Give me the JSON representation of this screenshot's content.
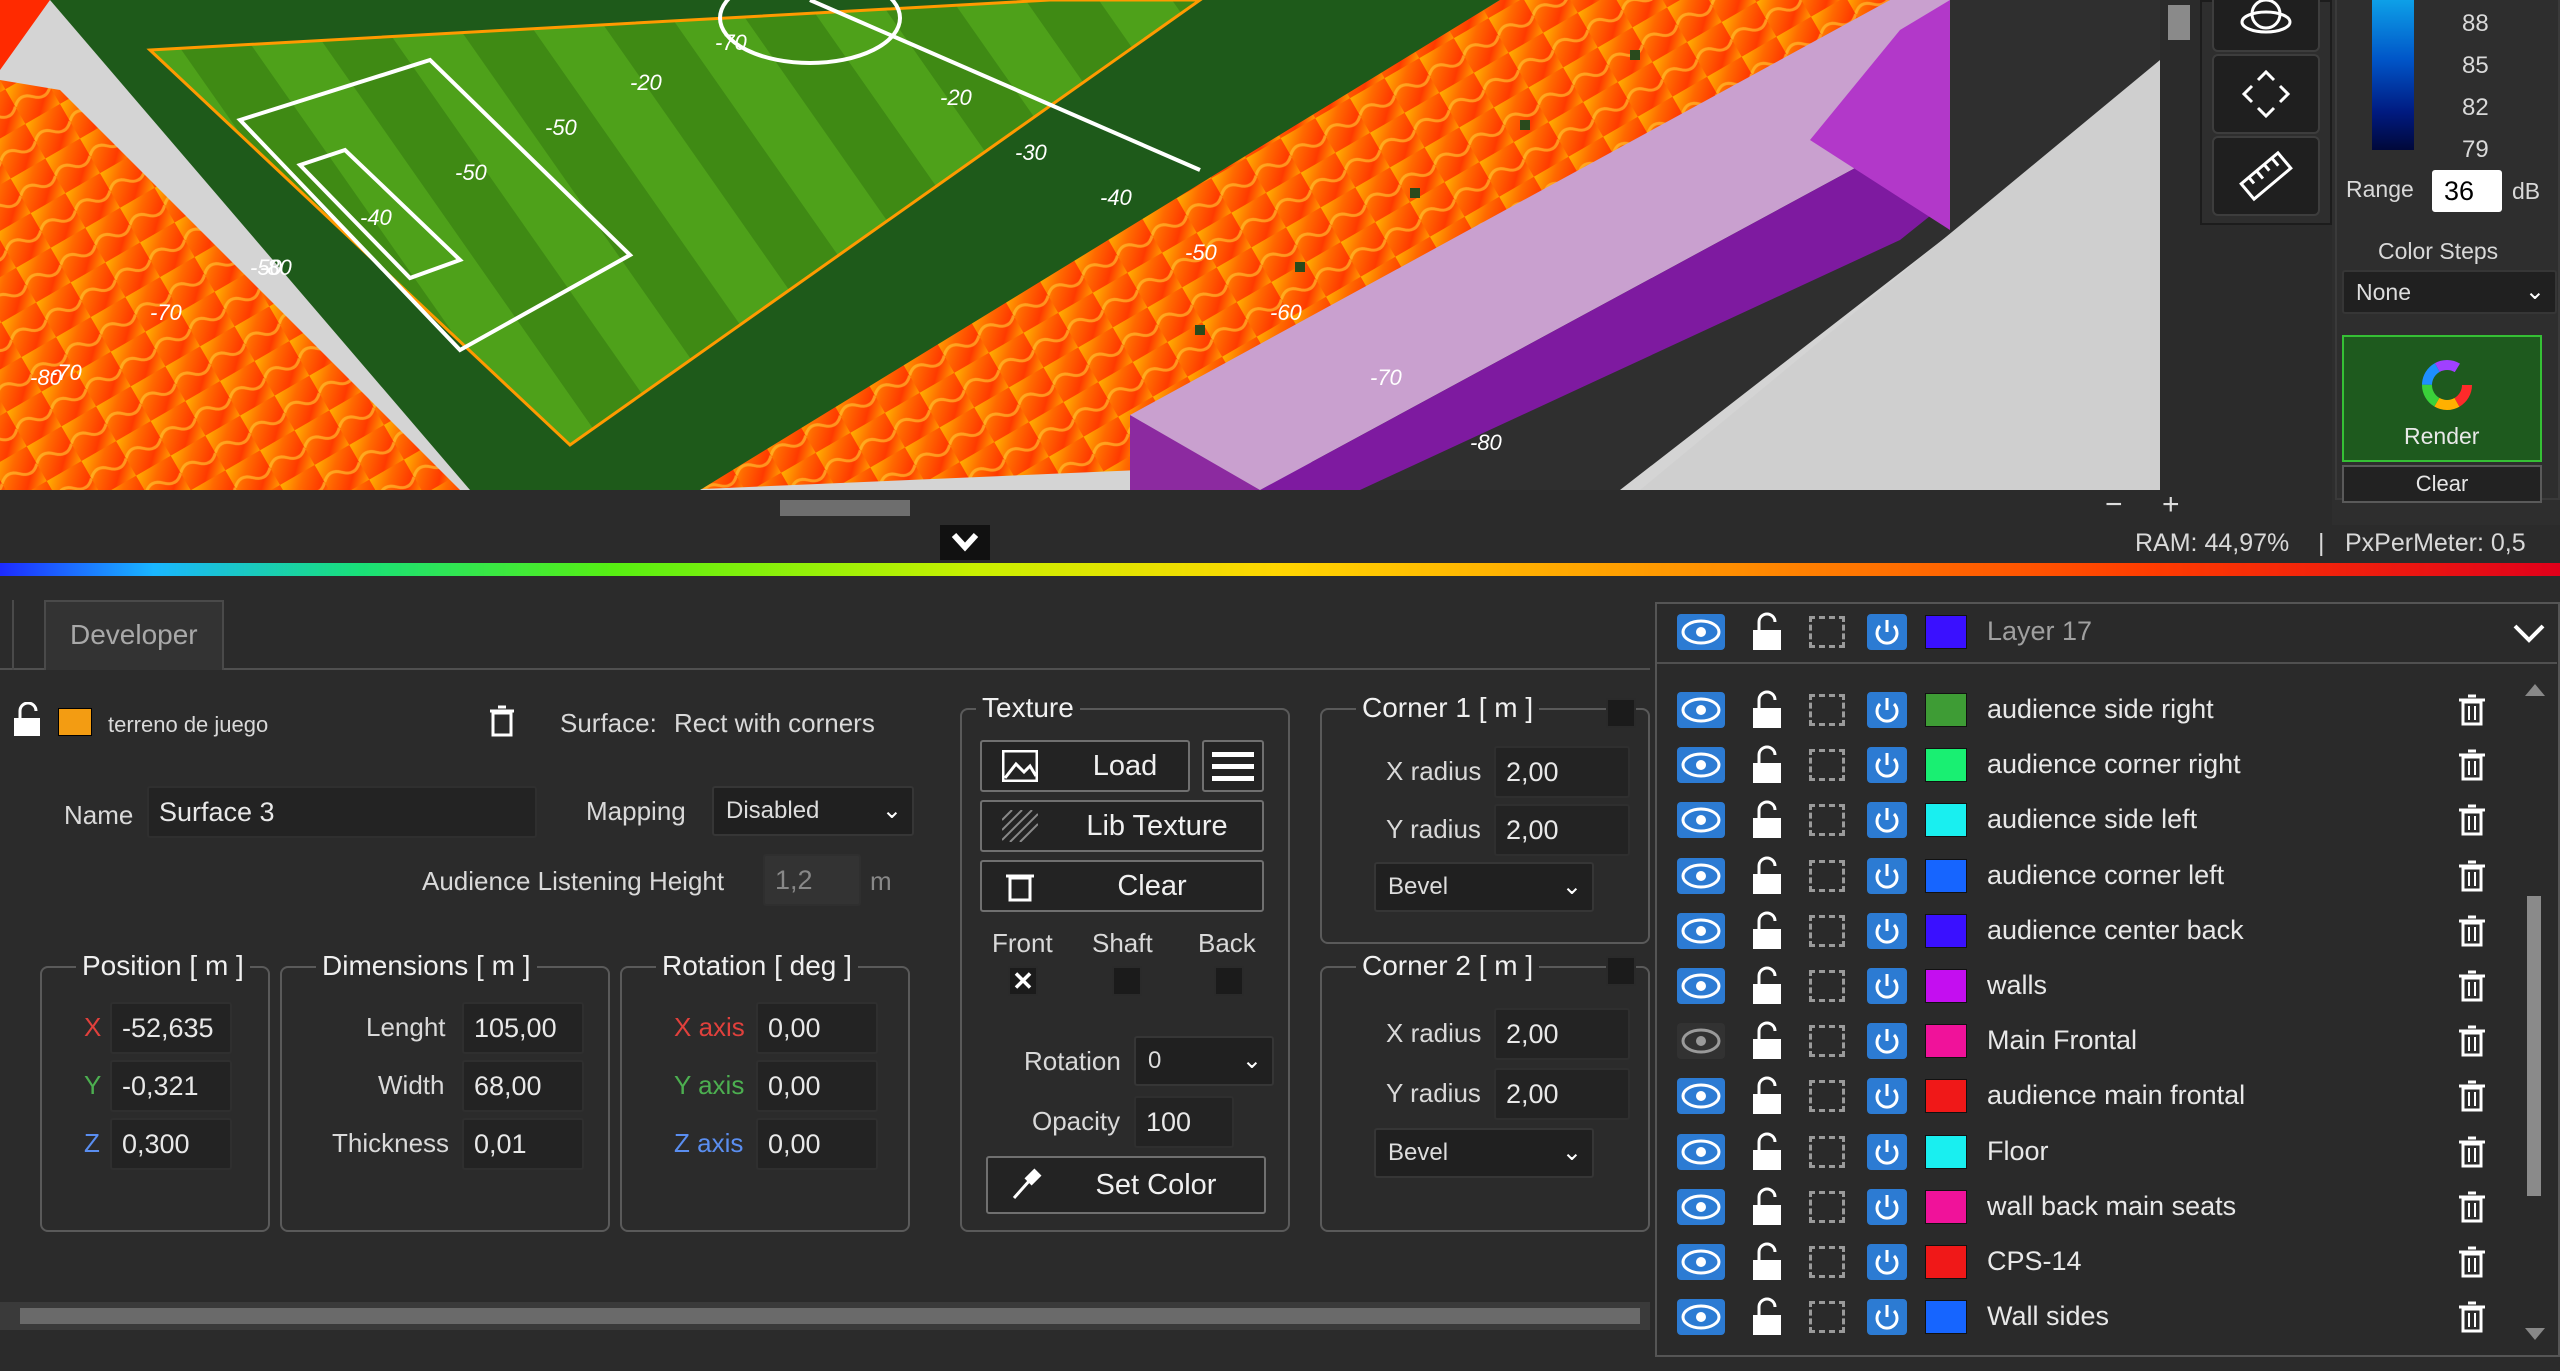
{
  "viewport": {
    "field_labels": [
      "-70",
      "-50",
      "-40",
      "-50",
      "-50",
      "-20",
      "-70",
      "-20",
      "-30",
      "-40",
      "-50",
      "-60",
      "-70",
      "-80",
      "-70",
      "-80",
      "-80"
    ],
    "scroll_minus": "−",
    "scroll_plus": "+"
  },
  "legend": {
    "values": [
      "88",
      "85",
      "82",
      "79"
    ],
    "range_label": "Range",
    "range_value": "36",
    "range_unit": "dB",
    "color_steps_label": "Color Steps",
    "color_steps_value": "None",
    "render_label": "Render",
    "clear_label": "Clear"
  },
  "status": {
    "ram": "RAM: 44,97%",
    "separator": "|",
    "px_per_meter": "PxPerMeter: 0,5"
  },
  "tabs": {
    "developer": "Developer"
  },
  "surface": {
    "layer_name": "terreno de juego",
    "layer_color": "#f39c12",
    "surface_label": "Surface:",
    "surface_type": "Rect with corners",
    "name_label": "Name",
    "name_value": "Surface 3",
    "mapping_label": "Mapping",
    "mapping_value": "Disabled",
    "listening_label": "Audience Listening Height",
    "listening_value": "1,2",
    "listening_unit": "m"
  },
  "position": {
    "title": "Position [ m ]",
    "x_label": "X",
    "x_value": "-52,635",
    "y_label": "Y",
    "y_value": "-0,321",
    "z_label": "Z",
    "z_value": "0,300"
  },
  "dimensions": {
    "title": "Dimensions [ m ]",
    "length_label": "Lenght",
    "length_value": "105,00",
    "width_label": "Width",
    "width_value": "68,00",
    "thickness_label": "Thickness",
    "thickness_value": "0,01"
  },
  "rotation": {
    "title": "Rotation [ deg ]",
    "x_label": "X axis",
    "x_value": "0,00",
    "y_label": "Y axis",
    "y_value": "0,00",
    "z_label": "Z axis",
    "z_value": "0,00"
  },
  "texture": {
    "title": "Texture",
    "load_label": "Load",
    "lib_label": "Lib Texture",
    "clear_label": "Clear",
    "front_label": "Front",
    "shaft_label": "Shaft",
    "back_label": "Back",
    "front_mark": "✕",
    "rotation_label": "Rotation",
    "rotation_value": "0",
    "opacity_label": "Opacity",
    "opacity_value": "100",
    "set_color_label": "Set Color"
  },
  "corner1": {
    "title": "Corner 1 [ m ]",
    "x_label": "X radius",
    "x_value": "2,00",
    "y_label": "Y radius",
    "y_value": "2,00",
    "type_value": "Bevel"
  },
  "corner2": {
    "title": "Corner 2  [ m ]",
    "x_label": "X radius",
    "x_value": "2,00",
    "y_label": "Y radius",
    "y_value": "2,00",
    "type_value": "Bevel"
  },
  "layers": {
    "header": {
      "name": "Layer 17",
      "color": "#3a10ff"
    },
    "items": [
      {
        "name": "audience side right",
        "color": "#3e9c35",
        "visible": true
      },
      {
        "name": "audience corner right",
        "color": "#19ef72",
        "visible": true
      },
      {
        "name": "audience side left",
        "color": "#19eff0",
        "visible": true
      },
      {
        "name": "audience corner left",
        "color": "#1665ff",
        "visible": true
      },
      {
        "name": "audience center back",
        "color": "#3a10ff",
        "visible": true
      },
      {
        "name": "walls",
        "color": "#c40ef0",
        "visible": true
      },
      {
        "name": "Main Frontal",
        "color": "#f0129a",
        "visible": false
      },
      {
        "name": "audience main frontal",
        "color": "#f01818",
        "visible": true
      },
      {
        "name": "Floor",
        "color": "#19eff0",
        "visible": true
      },
      {
        "name": "wall back main seats",
        "color": "#f0129a",
        "visible": true
      },
      {
        "name": "CPS-14",
        "color": "#f01818",
        "visible": true
      },
      {
        "name": "Wall sides",
        "color": "#1665ff",
        "visible": true
      }
    ]
  }
}
